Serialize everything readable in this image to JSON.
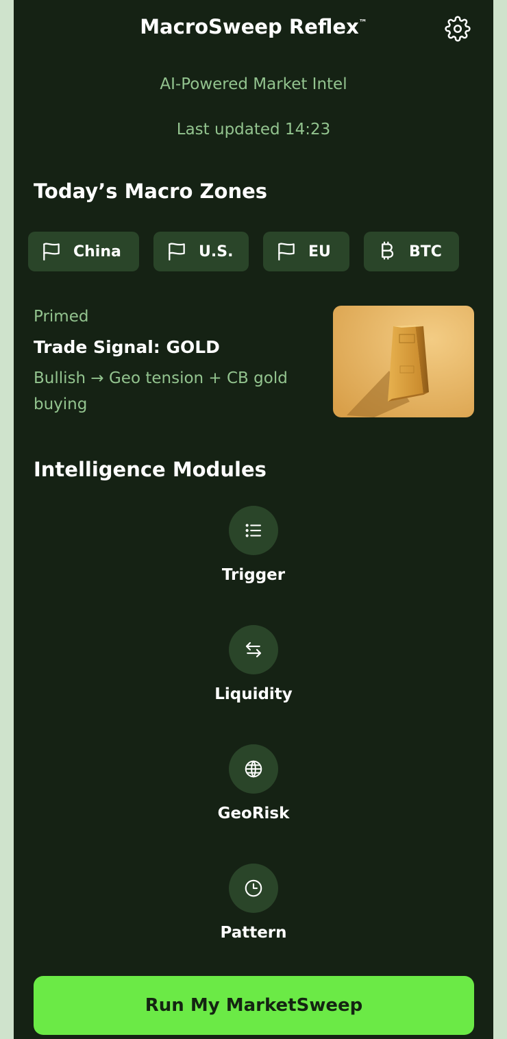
{
  "app": {
    "title": "MacroSweep Reflex",
    "trademark": "™",
    "subtitle": "AI-Powered Market Intel",
    "last_updated": "Last updated 14:23",
    "settings_icon": "gear-icon"
  },
  "zones": {
    "title": "Today’s Macro Zones",
    "items": [
      {
        "label": "China",
        "icon": "flag-icon"
      },
      {
        "label": "U.S.",
        "icon": "flag-icon"
      },
      {
        "label": "EU",
        "icon": "flag-icon"
      },
      {
        "label": "BTC",
        "icon": "bitcoin-icon"
      }
    ]
  },
  "signal": {
    "status": "Primed",
    "title": "Trade Signal: GOLD",
    "description": "Bullish → Geo tension + CB gold buying",
    "image": "gold-bar-image"
  },
  "modules": {
    "title": "Intelligence Modules",
    "items": [
      {
        "label": "Trigger",
        "icon": "list-icon"
      },
      {
        "label": "Liquidity",
        "icon": "swap-arrows-icon"
      },
      {
        "label": "GeoRisk",
        "icon": "globe-icon"
      },
      {
        "label": "Pattern",
        "icon": "clock-icon"
      }
    ]
  },
  "actions": {
    "run_label": "Run My MarketSweep"
  },
  "colors": {
    "background": "#152214",
    "chip": "#2a4529",
    "muted_text": "#93c48f",
    "accent": "#6bea46"
  }
}
